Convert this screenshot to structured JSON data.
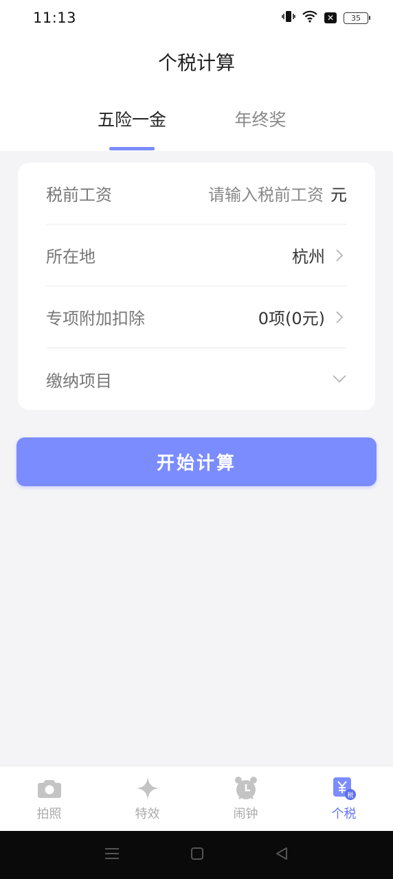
{
  "status_bar": {
    "time": "11:13",
    "battery": "35"
  },
  "header": {
    "title": "个税计算",
    "tabs": [
      {
        "label": "五险一金",
        "active": true
      },
      {
        "label": "年终奖",
        "active": false
      }
    ]
  },
  "form": {
    "salary": {
      "label": "税前工资",
      "placeholder": "请输入税前工资",
      "unit": "元"
    },
    "location": {
      "label": "所在地",
      "value": "杭州"
    },
    "deduction": {
      "label": "专项附加扣除",
      "value": "0项(0元)"
    },
    "items": {
      "label": "缴纳项目"
    }
  },
  "start_button": {
    "label": "开始计算"
  },
  "bottom_nav": {
    "items": [
      {
        "label": "拍照",
        "icon": "camera-icon"
      },
      {
        "label": "特效",
        "icon": "sparkle-icon"
      },
      {
        "label": "闹钟",
        "icon": "alarm-clock-icon"
      },
      {
        "label": "个税",
        "icon": "tax-yuan-icon",
        "active": true
      }
    ]
  },
  "colors": {
    "accent": "#7b8cff",
    "active_nav": "#6477f5",
    "background": "#f4f4f6"
  }
}
